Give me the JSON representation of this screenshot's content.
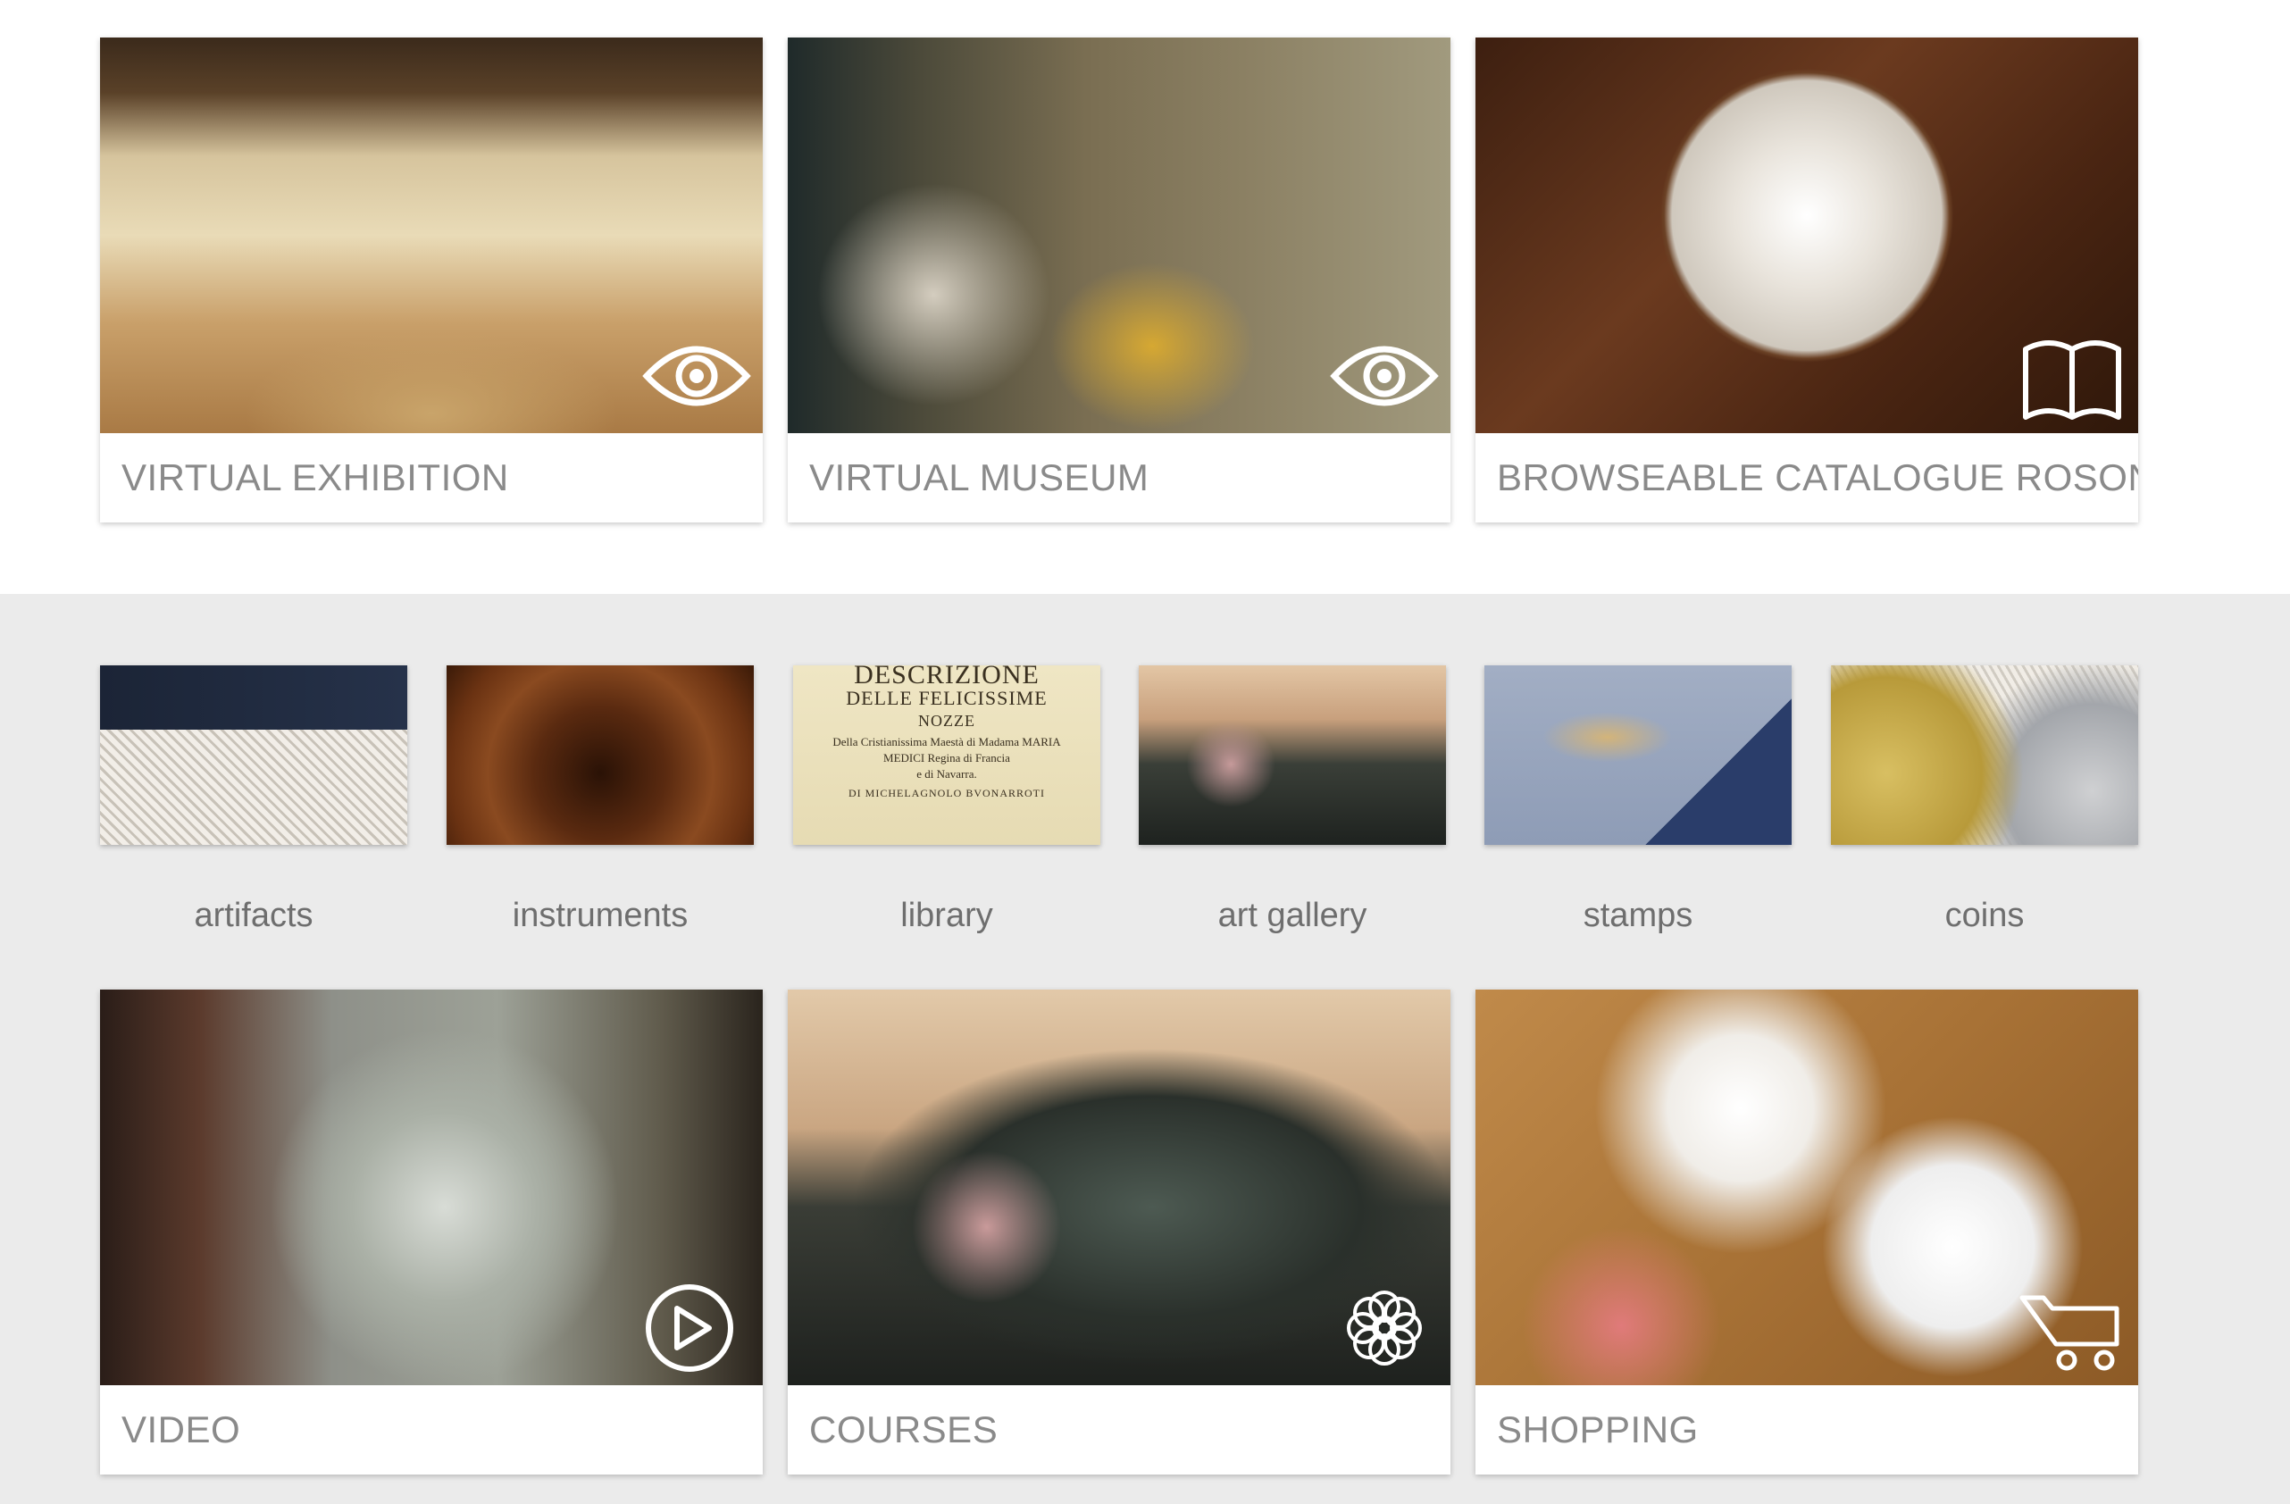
{
  "cards_top": [
    {
      "label": "VIRTUAL EXHIBITION",
      "icon": "eye-icon"
    },
    {
      "label": "VIRTUAL MUSEUM",
      "icon": "eye-icon"
    },
    {
      "label": "BROWSEABLE CATALOGUE ROSONI",
      "icon": "book-icon"
    }
  ],
  "thumbs": [
    {
      "label": "artifacts"
    },
    {
      "label": "instruments"
    },
    {
      "label": "library"
    },
    {
      "label": "art gallery"
    },
    {
      "label": "stamps"
    },
    {
      "label": "coins"
    }
  ],
  "library_text": {
    "line1": "DESCRIZIONE",
    "line2": "DELLE FELICISSIME",
    "line3": "NOZZE",
    "line4": "Della Cristianissima Maestà di Madama MARIA",
    "line5": "MEDICI Regina di Francia",
    "line6": "e di Navarra.",
    "line7": "DI MICHELAGNOLO BVONARROTI"
  },
  "cards_bottom": [
    {
      "label": "VIDEO",
      "icon": "play-icon"
    },
    {
      "label": "COURSES",
      "icon": "flower-icon"
    },
    {
      "label": "SHOPPING",
      "icon": "cart-icon"
    }
  ],
  "colors": {
    "caption_text": "#8a8a8a",
    "thumb_label_text": "#6e6e6e",
    "gray_band": "#ebebeb",
    "card_background": "#ffffff"
  }
}
